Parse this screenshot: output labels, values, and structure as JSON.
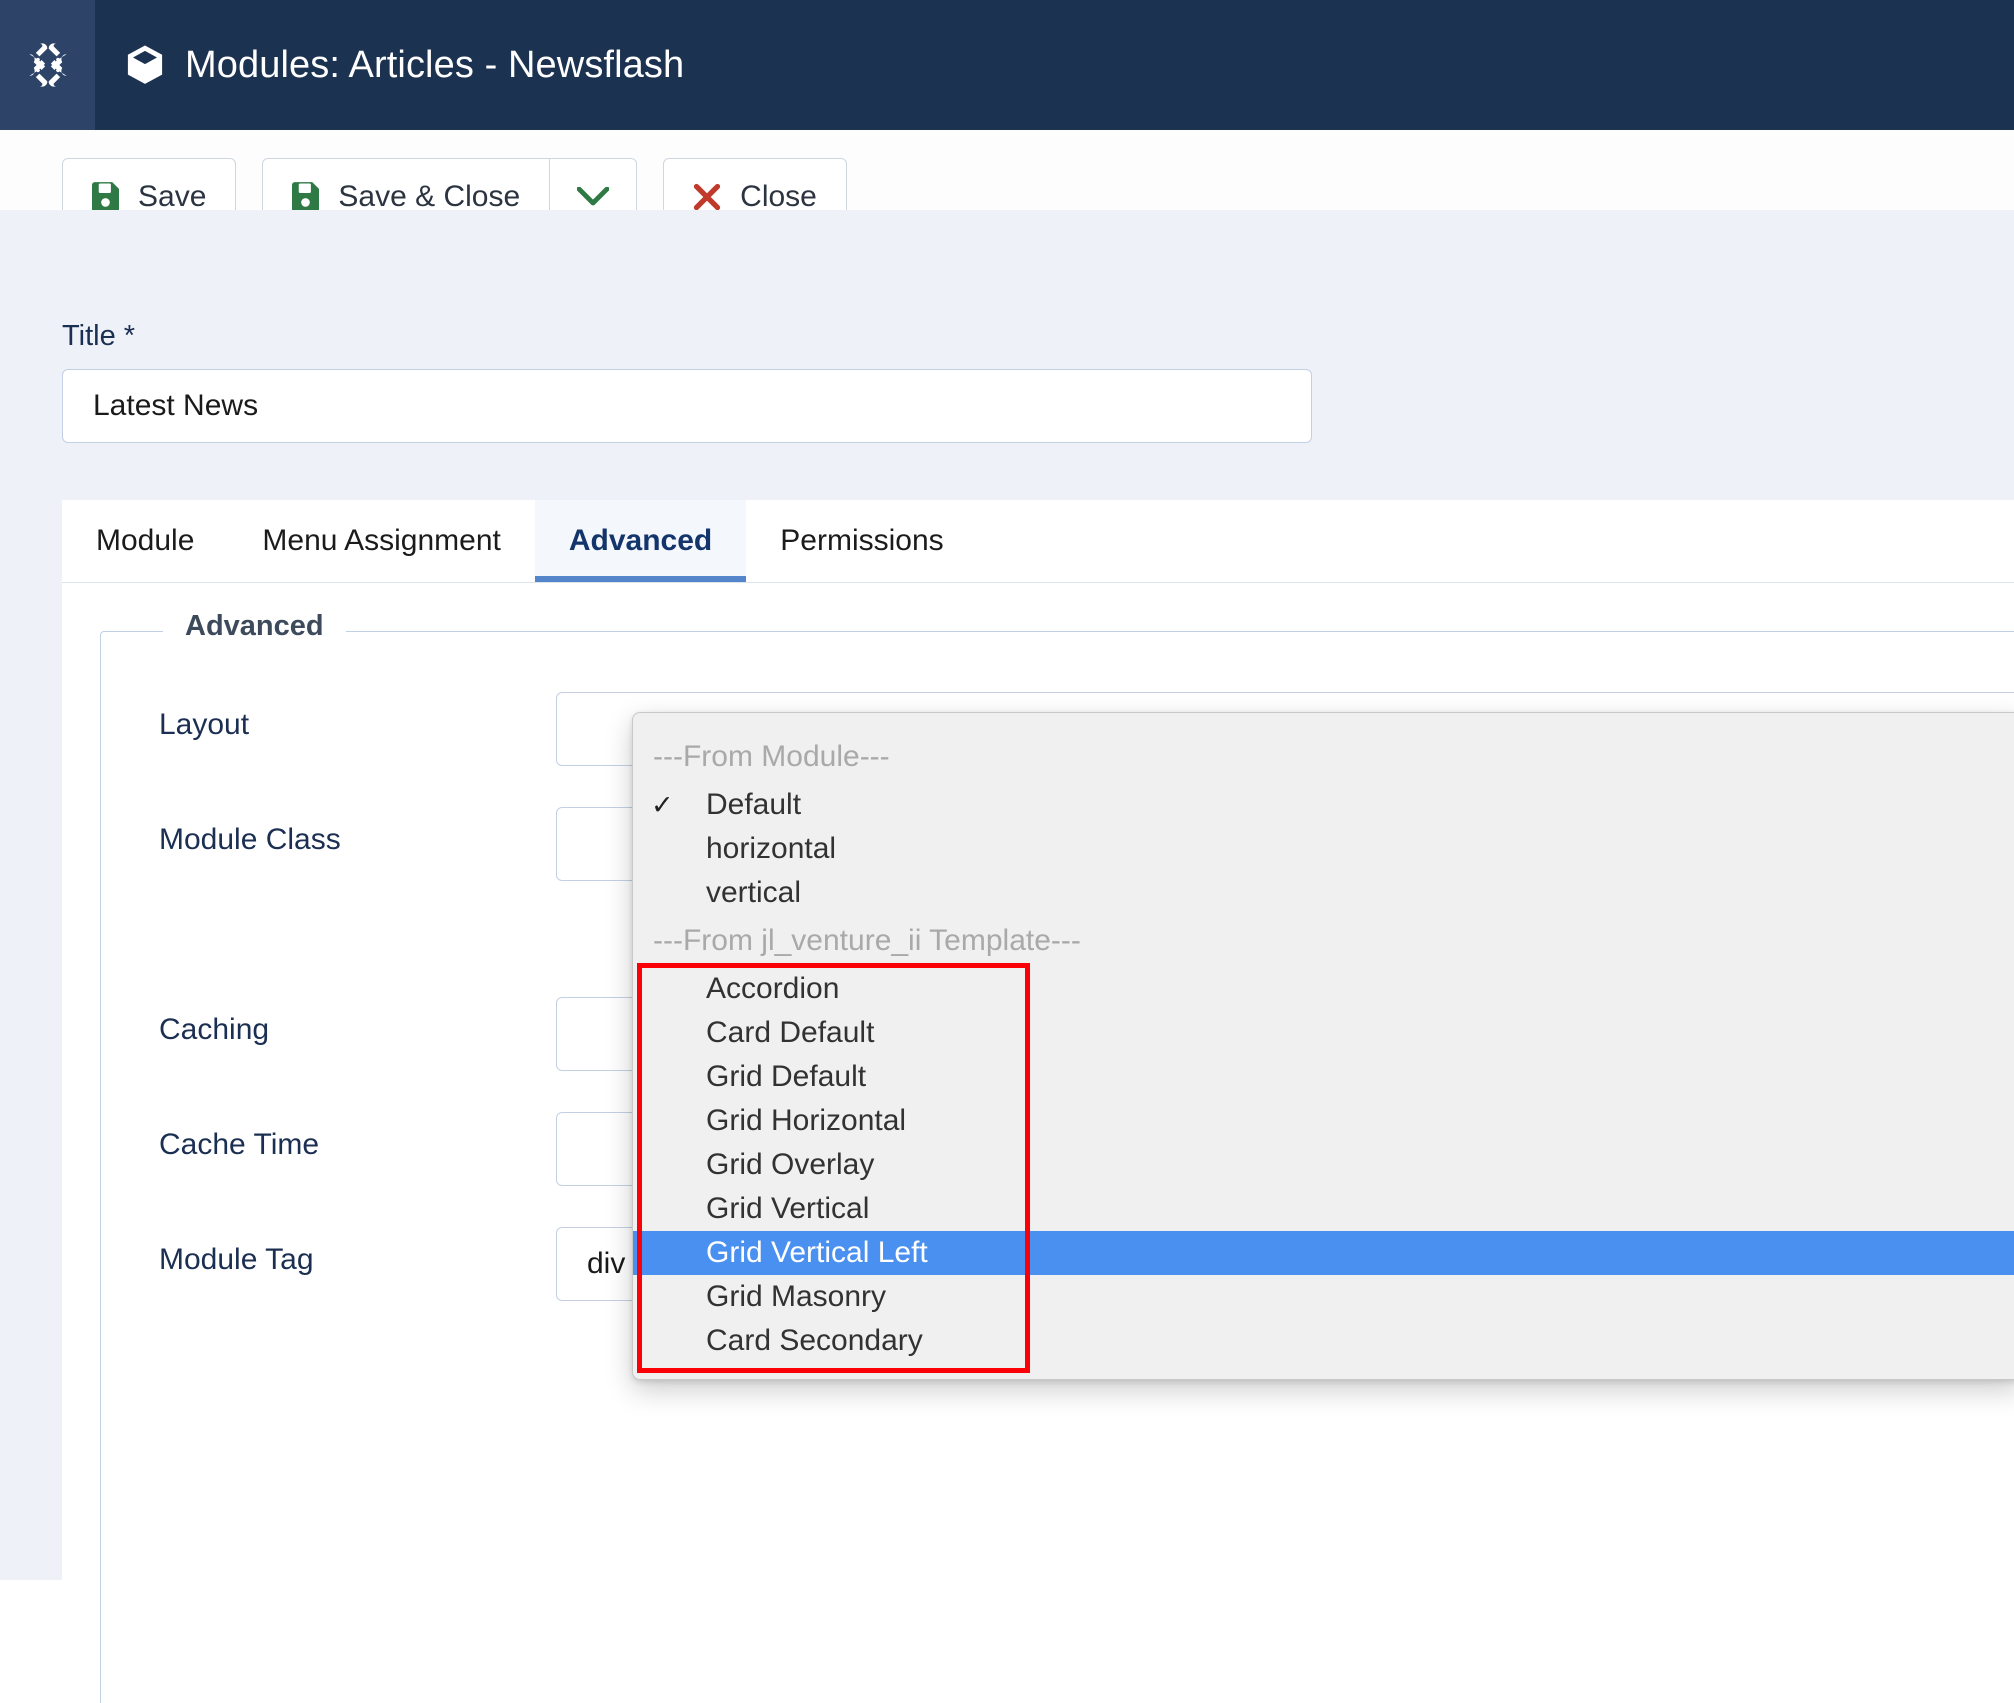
{
  "header": {
    "title": "Modules: Articles - Newsflash",
    "logo_icon": "joomla-logo-icon",
    "page_icon": "cube-icon"
  },
  "toolbar": {
    "save_label": "Save",
    "save_icon": "floppy-disk-icon",
    "save_close_label": "Save & Close",
    "save_close_icon": "floppy-disk-icon",
    "dropdown_icon": "chevron-down-icon",
    "close_label": "Close",
    "close_icon": "x-mark-icon"
  },
  "form": {
    "title_label": "Title *",
    "title_value": "Latest News",
    "title_placeholder": ""
  },
  "tabs": [
    {
      "label": "Module",
      "active": false
    },
    {
      "label": "Menu Assignment",
      "active": false
    },
    {
      "label": "Advanced",
      "active": true
    },
    {
      "label": "Permissions",
      "active": false
    }
  ],
  "fieldset": {
    "legend": "Advanced",
    "rows": [
      {
        "label": "Layout"
      },
      {
        "label": "Module Class"
      },
      {
        "label": "Caching"
      },
      {
        "label": "Cache Time"
      },
      {
        "label": "Module Tag",
        "value": "div"
      }
    ]
  },
  "dropdown": {
    "groups": [
      {
        "label": "---From Module---",
        "items": [
          {
            "label": "Default",
            "checked": true,
            "highlighted": false
          },
          {
            "label": "horizontal",
            "checked": false,
            "highlighted": false
          },
          {
            "label": "vertical",
            "checked": false,
            "highlighted": false
          }
        ]
      },
      {
        "label": "---From jl_venture_ii Template---",
        "items": [
          {
            "label": "Accordion",
            "checked": false,
            "highlighted": false
          },
          {
            "label": "Card Default",
            "checked": false,
            "highlighted": false
          },
          {
            "label": "Grid Default",
            "checked": false,
            "highlighted": false
          },
          {
            "label": "Grid Horizontal",
            "checked": false,
            "highlighted": false
          },
          {
            "label": "Grid Overlay",
            "checked": false,
            "highlighted": false
          },
          {
            "label": "Grid Vertical",
            "checked": false,
            "highlighted": false
          },
          {
            "label": "Grid Vertical Left",
            "checked": false,
            "highlighted": true
          },
          {
            "label": "Grid Masonry",
            "checked": false,
            "highlighted": false
          },
          {
            "label": "Card Secondary",
            "checked": false,
            "highlighted": false
          }
        ]
      }
    ]
  },
  "colors": {
    "header_bg": "#1c3251",
    "header_logo_bg": "#2d4468",
    "page_bg": "#eef1f8",
    "accent_blue": "#5484c9",
    "highlight_blue": "#4a90f0",
    "annotation_red": "#fb0007",
    "save_green": "#2f7a44",
    "close_red": "#c0392b"
  }
}
